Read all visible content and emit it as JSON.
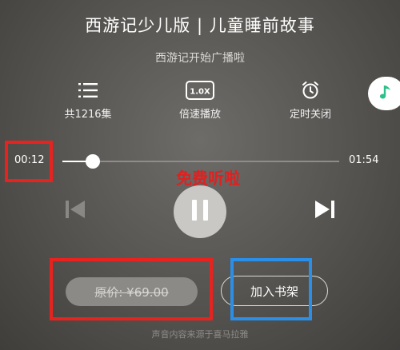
{
  "header": {
    "title": "西游记少儿版 | 儿童睡前故事",
    "subtitle": "西游记开始广播啦"
  },
  "controls": {
    "episodes_label": "共1216集",
    "speed_label": "倍速播放",
    "speed_badge": "1.0X",
    "timer_label": "定时关闭"
  },
  "player": {
    "current_time": "00:12",
    "total_time": "01:54",
    "progress_fraction": 0.11
  },
  "promo_text": "免费听啦",
  "actions": {
    "price_label": "原价: ¥69.00",
    "add_shelf_label": "加入书架"
  },
  "footer_text": "声音内容来源于喜马拉雅",
  "colors": {
    "annotation_red": "#e8231f",
    "annotation_blue": "#2b8fe8",
    "music_accent": "#2cc08a"
  },
  "icons": {
    "episodes": "list-icon",
    "speed": "speed-icon",
    "timer": "alarm-clock-icon",
    "music": "music-note-icon",
    "prev": "skip-previous-icon",
    "pause": "pause-icon",
    "next": "skip-next-icon"
  }
}
